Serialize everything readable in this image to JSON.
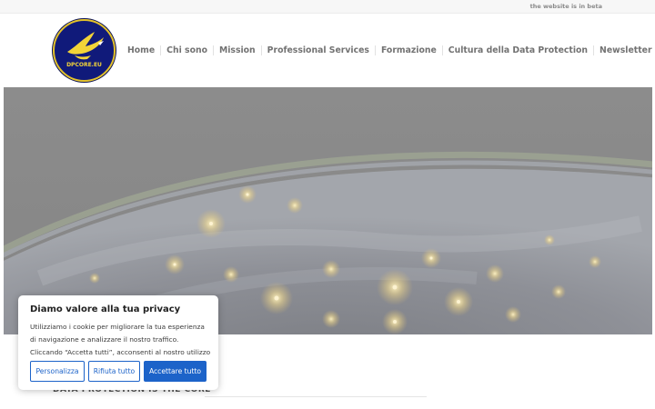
{
  "topbar": {
    "notice": "the website is in beta"
  },
  "logo": {
    "text": "DPCORE.EU",
    "icon": "eagle-emblem",
    "colors": {
      "ring": "#e3c22b",
      "field": "#101a7a"
    }
  },
  "nav": {
    "items": [
      {
        "label": "Home"
      },
      {
        "label": "Chi sono"
      },
      {
        "label": "Mission"
      },
      {
        "label": "Professional Services"
      },
      {
        "label": "Formazione"
      },
      {
        "label": "Cultura della Data Protection"
      },
      {
        "label": "Newsletter"
      }
    ]
  },
  "hero": {
    "image": "earth-at-night-from-space"
  },
  "section": {
    "heading": "DATA PROTECTION IS THE CORE"
  },
  "cookie_banner": {
    "title": "Diamo valore alla tua privacy",
    "body": "Utilizziamo i cookie per migliorare la tua esperienza di navigazione e analizzare il nostro traffico. Cliccando “Accetta tutti”, acconsenti al nostro utilizzo dei cookie.",
    "buttons": {
      "customize": "Personalizza",
      "reject": "Rifiuta tutto",
      "accept": "Accettare tutto"
    },
    "accent_color": "#1c63c9"
  }
}
